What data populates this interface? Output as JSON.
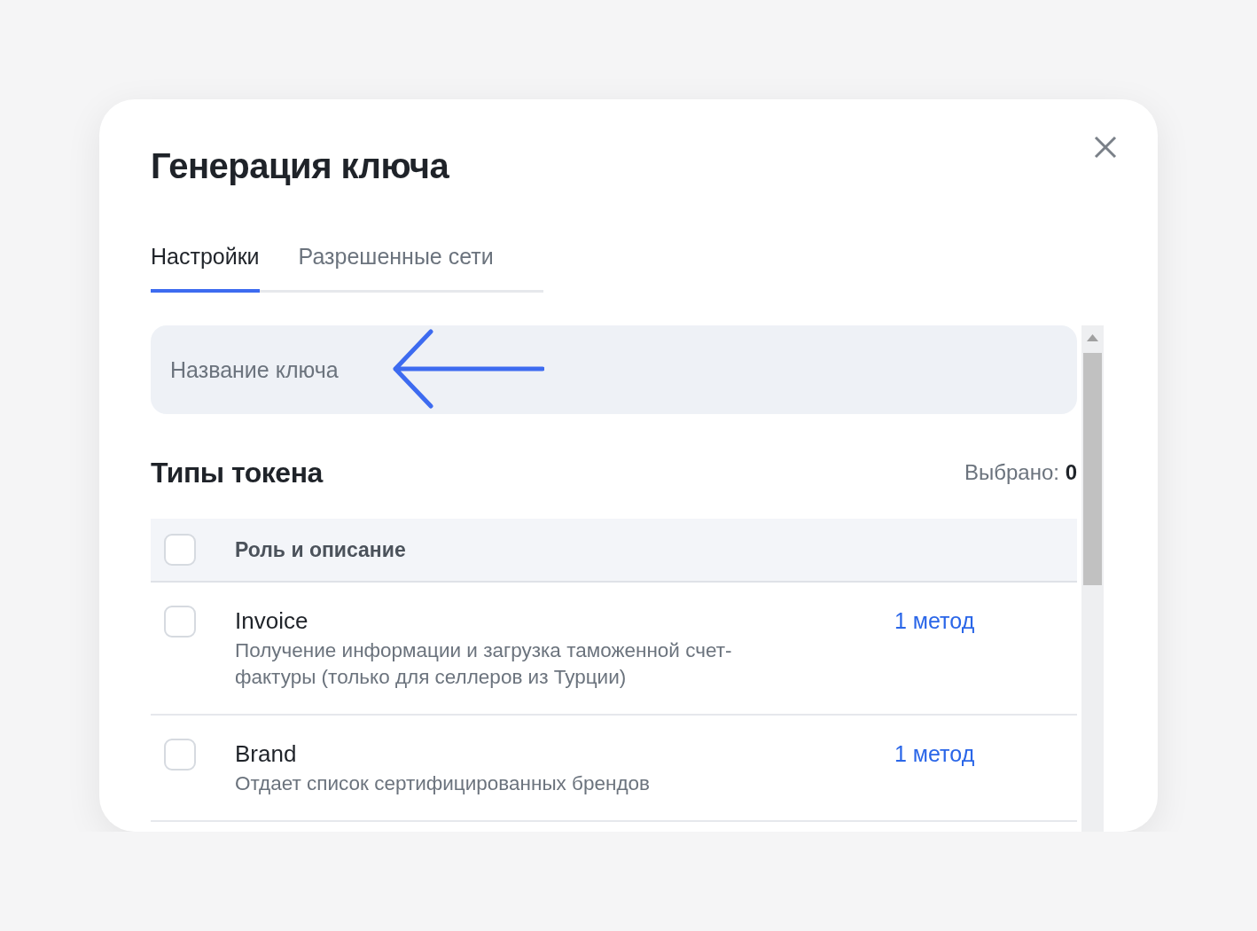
{
  "dialog": {
    "title": "Генерация ключа"
  },
  "tabs": [
    {
      "label": "Настройки",
      "selected": true
    },
    {
      "label": "Разрешенные сети",
      "selected": false
    }
  ],
  "key_name_field": {
    "placeholder": "Название ключа"
  },
  "token_types": {
    "heading": "Типы токена",
    "selected_count": "Выбрано: **0**"
  },
  "table": {
    "header": {
      "label": "Роль и описание",
      "checked": false
    },
    "rows": [
      {
        "name": "Invoice",
        "description": "Получение информации и загрузка таможенной счет-фактуры (только для селлеров из Турции)",
        "methods": "1 метод",
        "checked": false
      },
      {
        "name": "Brand",
        "description": "Отдает список сертифицированных брендов",
        "methods": "1 метод",
        "checked": false
      }
    ]
  }
}
